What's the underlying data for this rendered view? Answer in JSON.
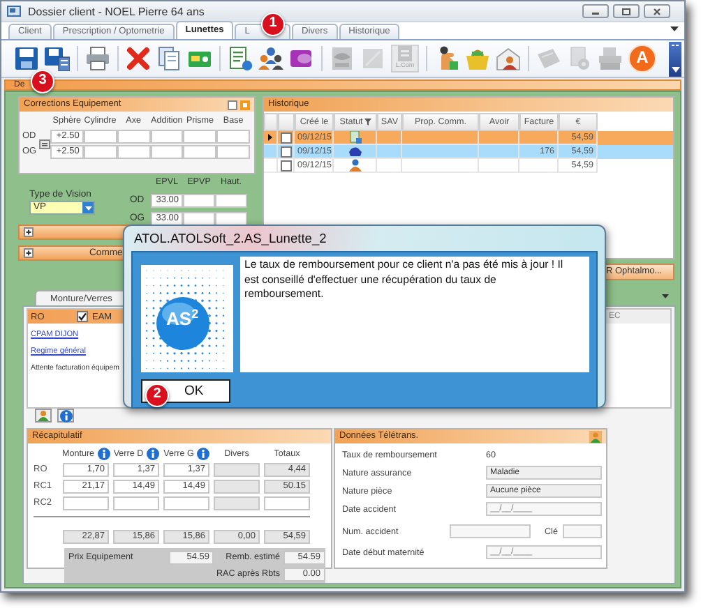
{
  "window": {
    "title": "Dossier client - NOEL Pierre 64 ans"
  },
  "tabs": [
    {
      "label": "Client",
      "selected": false
    },
    {
      "label": "Prescription / Optometrie",
      "selected": false
    },
    {
      "label": "Lunettes",
      "selected": true
    },
    {
      "label": "L",
      "selected": false
    },
    {
      "label": "Divers",
      "selected": false
    },
    {
      "label": "Historique",
      "selected": false
    }
  ],
  "toolbar": [
    {
      "kind": "icon",
      "disabled": false
    },
    {
      "kind": "icon",
      "disabled": false
    },
    {
      "kind": "separator"
    },
    {
      "kind": "icon",
      "disabled": false
    },
    {
      "kind": "separator"
    },
    {
      "kind": "icon",
      "disabled": false
    },
    {
      "kind": "icon",
      "disabled": false
    },
    {
      "kind": "icon",
      "disabled": false
    },
    {
      "kind": "separator"
    },
    {
      "kind": "icon",
      "disabled": false
    },
    {
      "kind": "icon",
      "disabled": false
    },
    {
      "kind": "icon",
      "disabled": false
    },
    {
      "kind": "separator"
    },
    {
      "kind": "icon",
      "disabled": true
    },
    {
      "kind": "icon",
      "disabled": true
    },
    {
      "kind": "labeled",
      "label": "L.Com",
      "disabled": true
    },
    {
      "kind": "separator"
    },
    {
      "kind": "icon",
      "disabled": false
    },
    {
      "kind": "icon",
      "disabled": false
    },
    {
      "kind": "icon",
      "disabled": false
    },
    {
      "kind": "separator"
    },
    {
      "kind": "icon",
      "disabled": true
    },
    {
      "kind": "icon",
      "disabled": true
    },
    {
      "kind": "icon",
      "disabled": true
    },
    {
      "kind": "letter",
      "label": "A",
      "disabled": false
    }
  ],
  "section_bar": {
    "label": "De"
  },
  "corrections": {
    "title": "Corrections Equipement",
    "columns": [
      "Sphère",
      "Cylindre",
      "Axe",
      "Addition",
      "Prisme",
      "Base"
    ],
    "rows": [
      {
        "eye": "OD",
        "values": [
          "+2.50"
        ]
      },
      {
        "eye": "OG",
        "values": [
          "+2.50"
        ]
      }
    ]
  },
  "vision": {
    "label": "Type de Vision",
    "value": "VP"
  },
  "ecarts": {
    "columns": [
      "EPVL",
      "EPVP",
      "Haut."
    ],
    "rows": [
      {
        "eye": "OD",
        "values": [
          "33.00"
        ]
      },
      {
        "eye": "OG",
        "values": [
          "33.00"
        ]
      }
    ]
  },
  "expanders": [
    {
      "expanded": false
    },
    {
      "expanded": false,
      "label": "Comme"
    }
  ],
  "history": {
    "title": "Historique",
    "columns": [
      "Créé le",
      "Statut",
      "SAV",
      "Prop. Comm.",
      "Avoir",
      "Facture",
      "€"
    ],
    "rows": [
      {
        "current": true,
        "selected": false,
        "checked": false,
        "date": "09/12/15",
        "amount": "54,59"
      },
      {
        "current": false,
        "selected": true,
        "checked": false,
        "date": "09/12/15",
        "invoice": "176",
        "amount": "54,59"
      },
      {
        "current": false,
        "selected": false,
        "checked": false,
        "date": "09/12/15",
        "amount": "54,59"
      }
    ]
  },
  "ophtalmo_button": {
    "label": "R Ophtalmo..."
  },
  "sub_tabs": [
    {
      "label": "Monture/Verres",
      "selected": true
    }
  ],
  "coverage": {
    "header": "RO",
    "eam": {
      "label": "EAM",
      "checked": true
    },
    "links": [
      "CPAM DIJON",
      "Regime général"
    ],
    "note": "Attente facturation équipem",
    "side_header": "EC"
  },
  "recap": {
    "title": "Récapitulatif",
    "columns": [
      {
        "label": "Monture",
        "info": true
      },
      {
        "label": "Verre D",
        "info": true
      },
      {
        "label": "Verre G",
        "info": true
      },
      {
        "label": "Divers",
        "info": false
      },
      {
        "label": "Totaux",
        "info": false
      }
    ],
    "rows": [
      {
        "label": "RO",
        "cells": [
          {
            "value": "1,70",
            "disabled": false
          },
          {
            "value": "1,37",
            "disabled": false
          },
          {
            "value": "1,37",
            "disabled": false
          },
          {
            "disabled": true
          },
          {
            "value": "4,44",
            "disabled": true
          }
        ]
      },
      {
        "label": "RC1",
        "cells": [
          {
            "value": "21,17",
            "disabled": false
          },
          {
            "value": "14,49",
            "disabled": false
          },
          {
            "value": "14,49",
            "disabled": false
          },
          {
            "disabled": true
          },
          {
            "value": "50.15",
            "disabled": true
          }
        ]
      },
      {
        "label": "RC2",
        "cells": [
          {
            "disabled": false
          },
          {
            "disabled": false
          },
          {
            "disabled": false
          },
          {
            "disabled": true
          },
          {
            "disabled": false
          }
        ]
      }
    ],
    "totals": [
      "22,87",
      "15,86",
      "15,86",
      "0,00",
      "54,59"
    ],
    "price": {
      "label": "Prix Equipement",
      "value": "54.59"
    },
    "estimate": {
      "label": "Remb. estimé",
      "value": "54.59"
    },
    "remainder": {
      "label": "RAC après Rbts",
      "value": "0.00"
    }
  },
  "teletrans": {
    "title": "Données Télétrans.",
    "rate": {
      "label": "Taux de remboursement",
      "value": "60"
    },
    "fields": [
      {
        "label": "Nature assurance",
        "value": "Maladie"
      },
      {
        "label": "Nature pièce",
        "value": "Aucune pièce"
      },
      {
        "label": "Date accident",
        "value": "__/__/____"
      }
    ],
    "accident": {
      "label": "Num. accident",
      "key_label": "Clé"
    },
    "maternity": {
      "label": "Date début maternité",
      "value": "__/__/____"
    }
  },
  "dialog": {
    "title": "ATOL.ATOLSoft_2.AS_Lunette_2",
    "logo": "AS$^{2}$",
    "message": "Le taux de remboursement pour ce client n'a pas été mis à jour ! Il est conseillé d'effectuer une récupération du taux de remboursement.",
    "button": "OK"
  },
  "callouts": [
    {
      "label": "1"
    },
    {
      "label": "2"
    },
    {
      "label": "3"
    }
  ]
}
